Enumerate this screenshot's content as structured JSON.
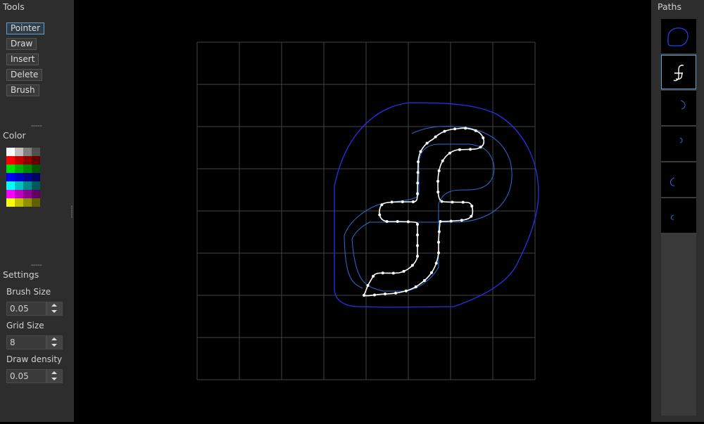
{
  "tools": {
    "title": "Tools",
    "buttons": [
      {
        "label": "Pointer",
        "active": true
      },
      {
        "label": "Draw"
      },
      {
        "label": "Insert"
      },
      {
        "label": "Delete"
      },
      {
        "label": "Brush"
      }
    ]
  },
  "color": {
    "title": "Color",
    "palette": [
      "#ffffff",
      "#c0c0c0",
      "#808080",
      "#505050",
      "#ff0000",
      "#c00000",
      "#900000",
      "#600000",
      "#00e000",
      "#00b000",
      "#008800",
      "#005500",
      "#0000ff",
      "#0000c0",
      "#000090",
      "#000060",
      "#00ffff",
      "#00c0c0",
      "#008c8c",
      "#005858",
      "#ff00ff",
      "#c000c0",
      "#900090",
      "#600060",
      "#ffff00",
      "#c0c000",
      "#909000",
      "#606000"
    ],
    "selected": 0
  },
  "settings": {
    "title": "Settings",
    "brush_size": {
      "label": "Brush Size",
      "value": "0.05"
    },
    "grid_size": {
      "label": "Grid Size",
      "value": "8"
    },
    "draw_density": {
      "label": "Draw density",
      "value": "0.05"
    }
  },
  "paths_panel": {
    "title": "Paths",
    "selected": 1,
    "thumbnails": [
      "outer-blob-path-icon",
      "f-glyph-path-icon",
      "arc-path-icon",
      "small-arc-path-icon",
      "c-arc-path-icon",
      "tiny-c-arc-path-icon"
    ]
  },
  "canvas": {
    "grid_divisions": 8,
    "colors": {
      "grid": "#444444",
      "outer": "#2233ee",
      "inner": "#2a6fd6",
      "path": "#ffffff",
      "background": "#000000",
      "thumb_outline": "#2244ee",
      "thumb_arc": "#2a6fd6"
    }
  }
}
